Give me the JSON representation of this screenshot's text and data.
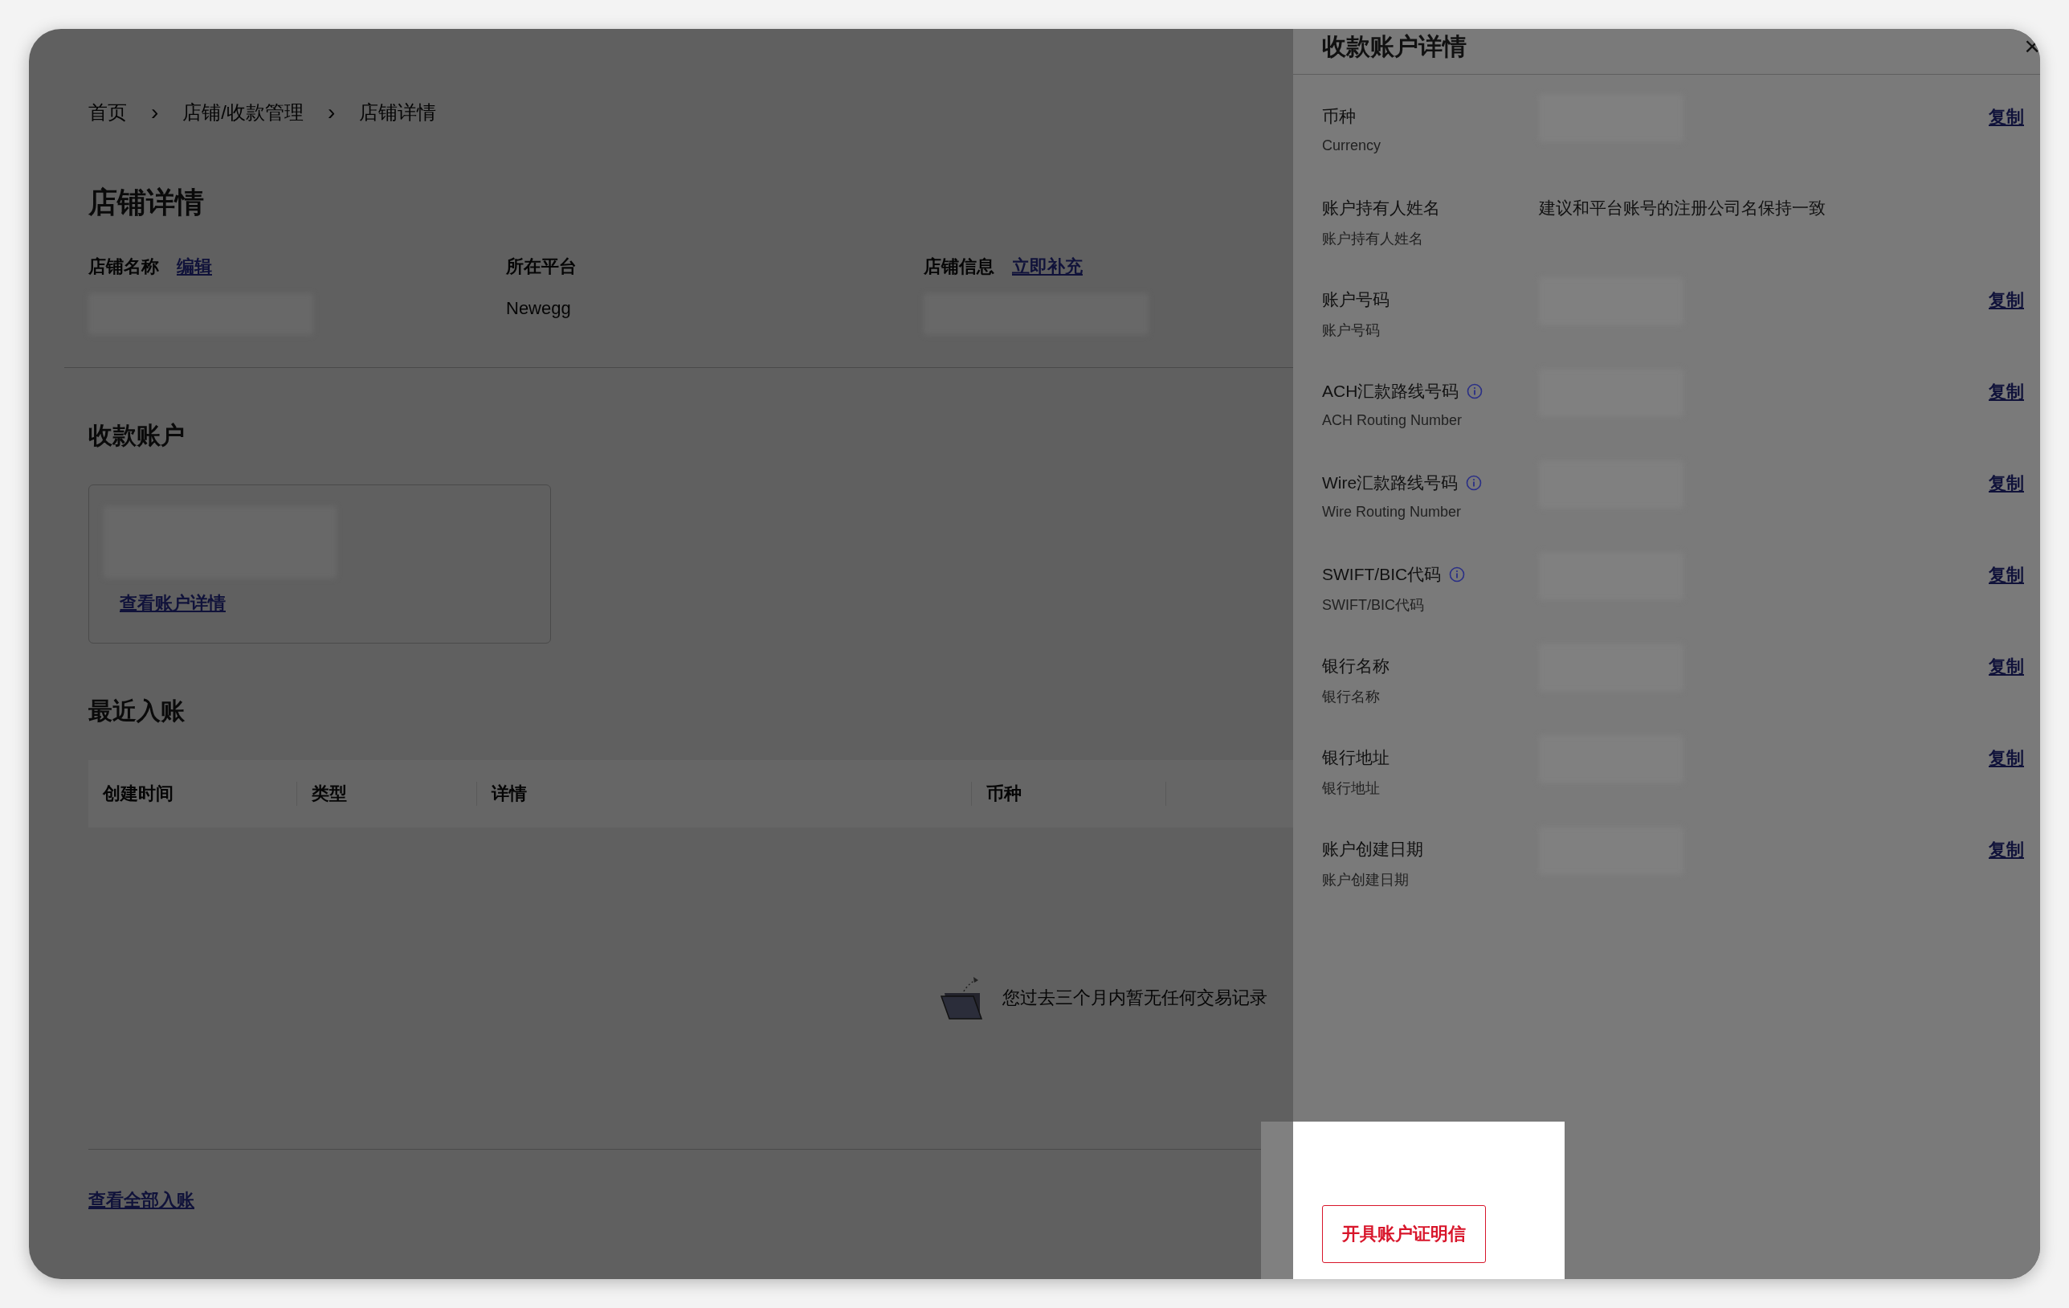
{
  "breadcrumb": [
    "首页",
    "店铺/收款管理",
    "店铺详情"
  ],
  "breadcrumb_separators": [
    "›",
    "›"
  ],
  "page_title": "店铺详情",
  "store_info": [
    {
      "kind": "blurred",
      "label": "店铺名称",
      "link": "编辑"
    },
    {
      "kind": "text",
      "label": "所在平台",
      "value": "Newegg"
    },
    {
      "kind": "blurred",
      "label": "店铺信息",
      "link": "立即补充"
    }
  ],
  "accounts": {
    "title": "收款账户",
    "card_link": "查看账户详情"
  },
  "recent": {
    "title": "最近入账",
    "columns": [
      "创建时间",
      "类型",
      "详情",
      "币种"
    ],
    "empty_text": "您过去三个月内暂无任何交易记录",
    "view_all": "查看全部入账"
  },
  "drawer": {
    "title": "收款账户详情",
    "close": "×",
    "fields": [
      {
        "kind": "blurred",
        "label": "币种",
        "sublabel": "Currency",
        "info": false,
        "copy": "复制"
      },
      {
        "kind": "text",
        "label": "账户持有人姓名",
        "sublabel": "账户持有人姓名",
        "info": false,
        "value": "建议和平台账号的注册公司名保持一致"
      },
      {
        "kind": "blurred",
        "label": "账户号码",
        "sublabel": "账户号码",
        "info": false,
        "copy": "复制"
      },
      {
        "kind": "blurred",
        "label": "ACH汇款路线号码",
        "sublabel": "ACH Routing Number",
        "info": true,
        "copy": "复制"
      },
      {
        "kind": "blurred",
        "label": "Wire汇款路线号码",
        "sublabel": "Wire Routing Number",
        "info": true,
        "copy": "复制"
      },
      {
        "kind": "blurred",
        "label": "SWIFT/BIC代码",
        "sublabel": "SWIFT/BIC代码",
        "info": true,
        "copy": "复制"
      },
      {
        "kind": "blurred",
        "label": "银行名称",
        "sublabel": "银行名称",
        "info": false,
        "copy": "复制"
      },
      {
        "kind": "blurred",
        "label": "银行地址",
        "sublabel": "银行地址",
        "info": false,
        "copy": "复制"
      },
      {
        "kind": "blurred",
        "label": "账户创建日期",
        "sublabel": "账户创建日期",
        "info": false,
        "copy": "复制"
      }
    ],
    "footer_button": "开具账户证明信"
  }
}
